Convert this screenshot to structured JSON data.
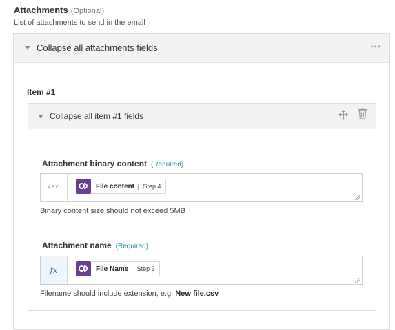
{
  "section": {
    "title": "Attachments",
    "optional": "(Optional)",
    "description": "List of attachments to send in the email",
    "collapse_all": "Collapse all attachments fields",
    "menu_glyph": "•••"
  },
  "item": {
    "title": "Item #1",
    "collapse": "Collapse all item #1 fields"
  },
  "fields": [
    {
      "label": "Attachment binary content",
      "required": "(Required)",
      "prefix": "ABC",
      "pill_text": "File content",
      "pill_step": "Step 4",
      "hint": "Binary content size should not exceed 5MB"
    },
    {
      "label": "Attachment name",
      "required": "(Required)",
      "prefix": "fx",
      "pill_text": "File Name",
      "pill_step": "Step 3",
      "hint_prefix": "Filename should include extension, e.g. ",
      "hint_bold": "New file.csv"
    }
  ],
  "icons": {
    "pill_icon_color": "#6a3f8e",
    "required_color": "#1a8ea0"
  }
}
